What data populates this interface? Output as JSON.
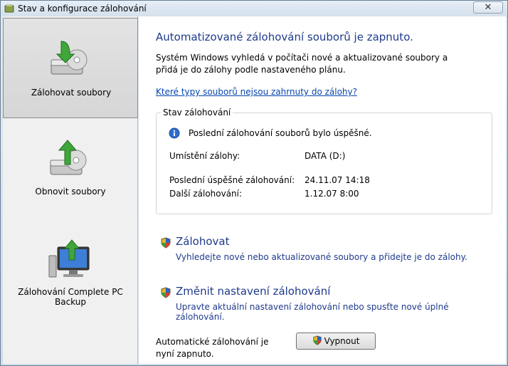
{
  "window": {
    "title": "Stav a konfigurace zálohování",
    "close_label": "✕"
  },
  "sidebar": {
    "items": [
      {
        "label": "Zálohovat soubory",
        "icon": "backup-files-icon",
        "selected": true
      },
      {
        "label": "Obnovit soubory",
        "icon": "restore-files-icon",
        "selected": false
      },
      {
        "label": "Zálohování Complete PC Backup",
        "icon": "complete-pc-backup-icon",
        "selected": false
      }
    ]
  },
  "main": {
    "heading": "Automatizované zálohování souborů je zapnuto.",
    "description": "Systém Windows vyhledá v počítači nové a aktualizované soubory a přidá je do zálohy podle nastaveného plánu.",
    "link": "Které typy souborů nejsou zahrnuty do zálohy?",
    "status": {
      "legend": "Stav zálohování",
      "message": "Poslední zálohování souborů bylo úspěšné.",
      "location_label": "Umístění zálohy:",
      "location_value": "DATA (D:)",
      "last_label": "Poslední úspěšné zálohování:",
      "last_value": "24.11.07 14:18",
      "next_label": "Další zálohování:",
      "next_value": "1.12.07 8:00"
    },
    "actions": [
      {
        "title": "Zálohovat",
        "desc": "Vyhledejte nové nebo aktualizované soubory a přidejte je do zálohy."
      },
      {
        "title": "Změnit nastavení zálohování",
        "desc": "Upravte aktuální nastavení zálohování nebo spusťte nové úplné zálohování."
      }
    ],
    "auto_text": "Automatické zálohování je nyní zapnuto.",
    "off_button": "Vypnout"
  }
}
